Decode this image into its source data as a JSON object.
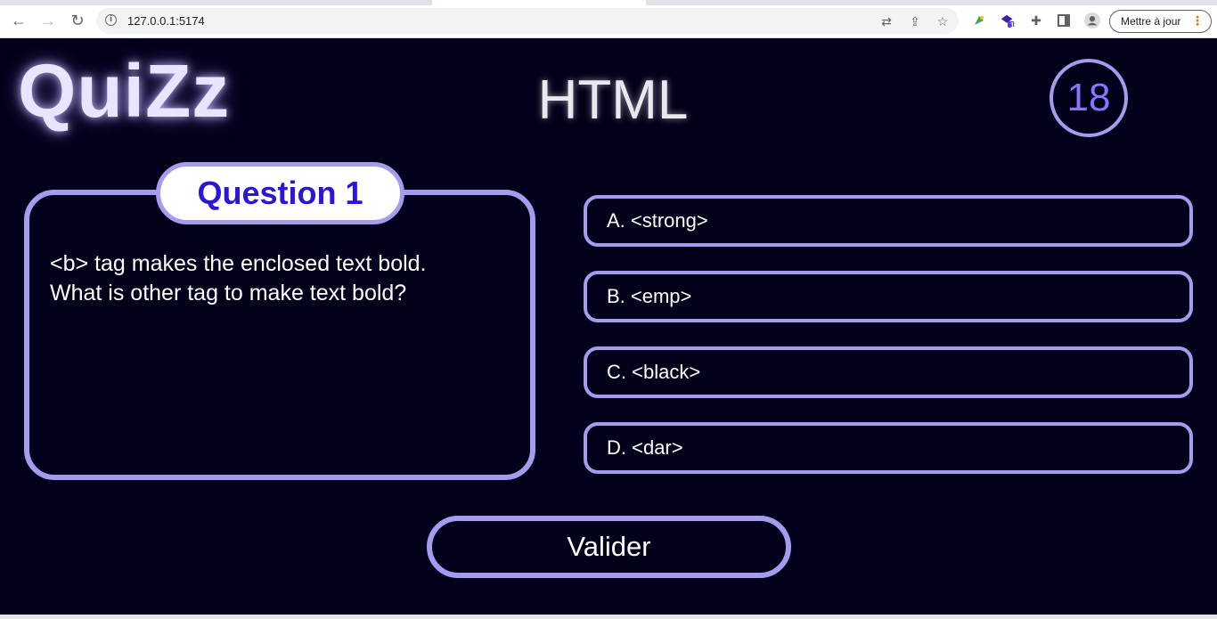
{
  "browser": {
    "url": "127.0.0.1:5174",
    "update_button": "Mettre à jour",
    "icons": [
      "back-arrow-icon",
      "forward-arrow-icon",
      "reload-icon",
      "site-info-icon",
      "translate-icon",
      "share-icon",
      "bookmark-star-icon",
      "extension-colorful-icon",
      "extension-badge-icon",
      "extensions-puzzle-icon",
      "side-panel-icon",
      "profile-icon",
      "menu-dots-icon"
    ],
    "extension_badge": "1"
  },
  "app": {
    "logo": "QuiZz",
    "topic": "HTML",
    "timer": "18",
    "question": {
      "label": "Question 1",
      "line1": "<b> tag makes the enclosed text bold.",
      "line2": "What is other tag to make text bold?"
    },
    "answers": [
      {
        "text": "A. <strong>"
      },
      {
        "text": "B. <emp>"
      },
      {
        "text": "C. <black>"
      },
      {
        "text": "D. <dar>"
      }
    ],
    "validate_label": "Valider",
    "colors": {
      "background": "#02001a",
      "accent": "#a59cf0",
      "question_label": "#2b16d8",
      "timer_text": "#8a74ff"
    }
  }
}
